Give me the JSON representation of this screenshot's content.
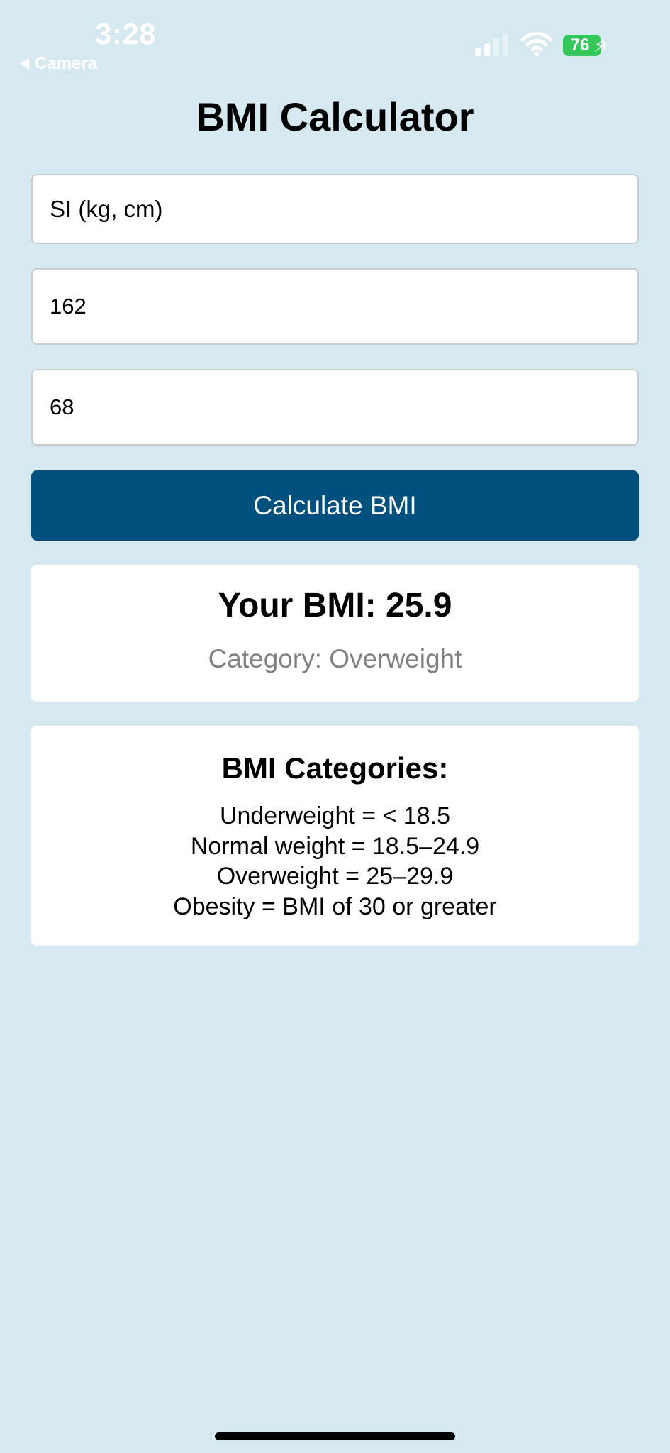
{
  "status_bar": {
    "time": "3:28",
    "back_label": "Camera",
    "battery_level": "76",
    "signal_icon": "cellular-signal-icon",
    "wifi_icon": "wifi-icon",
    "battery_icon": "battery-charging-icon"
  },
  "page": {
    "title": "BMI Calculator"
  },
  "form": {
    "unit_system": "SI (kg, cm)",
    "height_value": "162",
    "weight_value": "68",
    "calculate_label": "Calculate BMI"
  },
  "result": {
    "heading": "Your BMI: 25.9",
    "category": "Category: Overweight"
  },
  "categories": {
    "heading": "BMI Categories:",
    "items": [
      "Underweight = < 18.5",
      "Normal weight = 18.5–24.9",
      "Overweight = 25–29.9",
      "Obesity = BMI of 30 or greater"
    ]
  },
  "colors": {
    "background": "#d6e9f0",
    "button": "#00507d",
    "battery": "#34c759",
    "muted_text": "#808080"
  }
}
